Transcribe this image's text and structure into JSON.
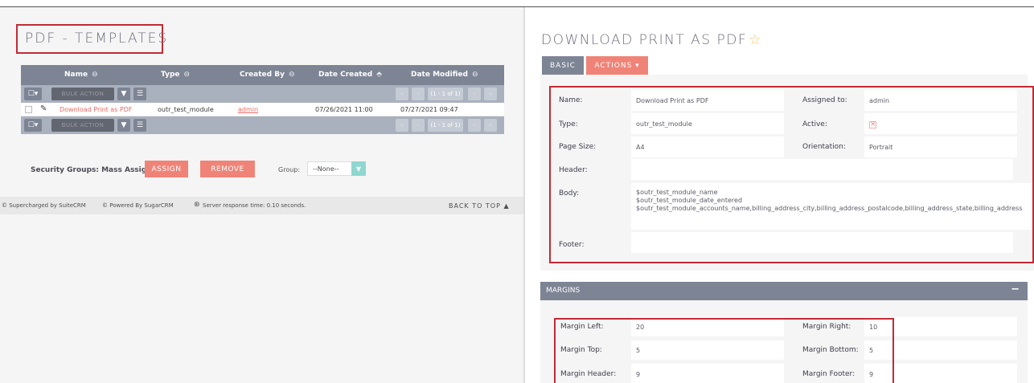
{
  "left": {
    "title": "PDF - TEMPLATES",
    "columns": [
      "Name",
      "Type",
      "Created By",
      "Date Created",
      "Date Modified"
    ],
    "bulk_action_label": "BULK ACTION",
    "pagination": "(1 - 1 of 1)",
    "row": {
      "name": "Download Print as PDF",
      "type": "outr_test_module",
      "created_by": "admin",
      "date_created": "07/26/2021 11:00",
      "date_modified": "07/27/2021 09:47"
    },
    "security_groups_label": "Security Groups: Mass Assign",
    "assign_label": "ASSIGN",
    "remove_label": "REMOVE",
    "group_label": "Group:",
    "group_value": "--None--",
    "footer": {
      "supercharged": "© Supercharged by SuiteCRM",
      "powered": "© Powered By SugarCRM",
      "server_time": "Server response time: 0.10 seconds.",
      "back_to_top": "BACK TO TOP ▲"
    }
  },
  "right": {
    "title": "DOWNLOAD PRINT AS PDF",
    "tab_basic": "BASIC",
    "tab_actions": "ACTIONS ▾",
    "fields": {
      "name_label": "Name:",
      "name_value": "Download Print as PDF",
      "assigned_label": "Assigned to:",
      "assigned_value": "admin",
      "type_label": "Type:",
      "type_value": "outr_test_module",
      "active_label": "Active:",
      "page_size_label": "Page Size:",
      "page_size_value": "A4",
      "orientation_label": "Orientation:",
      "orientation_value": "Portrait",
      "header_label": "Header:",
      "body_label": "Body:",
      "body_line1": "$outr_test_module_name",
      "body_line2": "$outr_test_module_date_entered",
      "body_line3": "$outr_test_module_accounts_name,billing_address_city,billing_address_postalcode,billing_address_state,billing_address",
      "footer_label": "Footer:"
    },
    "margins_title": "MARGINS",
    "margins": {
      "left_label": "Margin Left:",
      "left_value": "20",
      "right_label": "Margin Right:",
      "right_value": "10",
      "top_label": "Margin Top:",
      "top_value": "5",
      "bottom_label": "Margin Bottom:",
      "bottom_value": "5",
      "header_label": "Margin Header:",
      "header_value": "9",
      "footer_label": "Margin Footer:",
      "footer_value": "9"
    }
  },
  "colors": {
    "header_gray": "#7d8494",
    "accent_coral": "#f08377",
    "highlight_red": "#c12a35"
  }
}
